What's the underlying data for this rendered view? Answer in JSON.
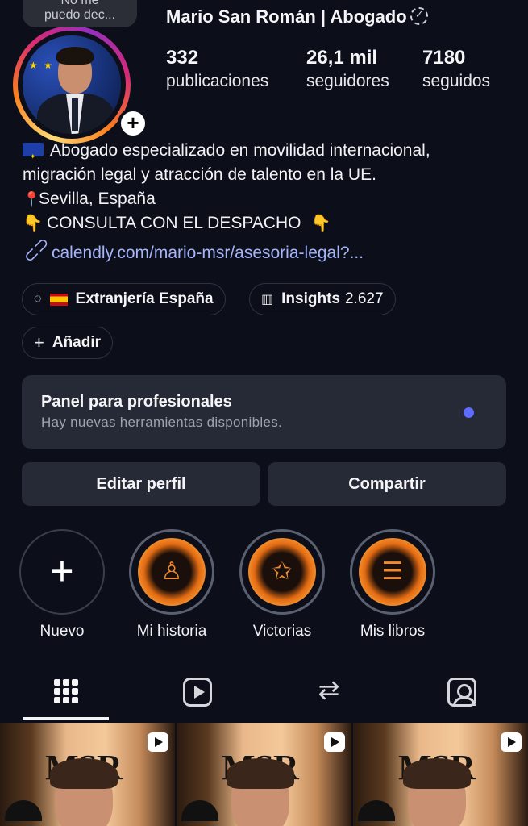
{
  "header": {
    "note_line1": "No me",
    "note_line2": "puedo dec...",
    "profile_name": "Mario San Román | Abogado"
  },
  "stats": [
    {
      "value": "332",
      "label": "publicaciones"
    },
    {
      "value": "26,1 mil",
      "label": "seguidores"
    },
    {
      "value": "7180",
      "label": "seguidos"
    }
  ],
  "bio": {
    "line1": "Abogado especializado en movilidad internacional,",
    "line2": "migración legal y atracción de talento en la UE.",
    "line3": "Sevilla, España",
    "line4": "CONSULTA CON EL DESPACHO",
    "link": "calendly.com/mario-msr/asesoria-legal?..."
  },
  "chips": {
    "threads_label": "Extranjería España",
    "insights_label": "Insights",
    "insights_count": "2.627",
    "add_label": "Añadir"
  },
  "panel": {
    "title": "Panel para profesionales",
    "subtitle": "Hay nuevas herramientas disponibles."
  },
  "buttons": {
    "edit": "Editar perfil",
    "share": "Compartir"
  },
  "highlights": [
    {
      "label": "Nuevo",
      "icon": "plus-icon"
    },
    {
      "label": "Mi historia",
      "icon": "person-icon"
    },
    {
      "label": "Victorias",
      "icon": "handshake-icon"
    },
    {
      "label": "Mis libros",
      "icon": "books-icon"
    }
  ],
  "tabs": [
    {
      "icon": "grid-icon",
      "active": true
    },
    {
      "icon": "reels-icon",
      "active": false
    },
    {
      "icon": "repost-icon",
      "active": false
    },
    {
      "icon": "tagged-icon",
      "active": false
    }
  ],
  "posts": [
    {
      "logo": "MSR",
      "type": "reel"
    },
    {
      "logo": "MSR",
      "type": "reel"
    },
    {
      "logo": "MSR",
      "type": "reel"
    }
  ],
  "colors": {
    "background": "#0c0f1a",
    "surface": "#262a36",
    "link": "#a5b4fc",
    "notification_dot": "#5e6bff",
    "highlight_accent": "#f08a2a"
  }
}
